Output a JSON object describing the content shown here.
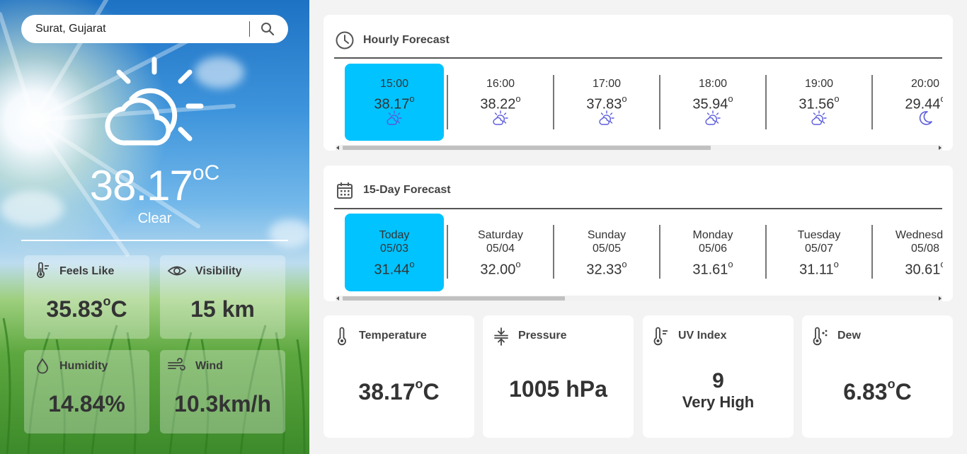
{
  "search": {
    "value": "Surat, Gujarat",
    "icon": "search-icon"
  },
  "current": {
    "temp": "38.17",
    "unit": "oC",
    "condition": "Clear",
    "icon": "sun-cloud-icon"
  },
  "tiles": {
    "feels_like": {
      "label": "Feels Like",
      "value": "35.83",
      "unit": "C",
      "deg": "o",
      "icon": "thermometer-icon"
    },
    "visibility": {
      "label": "Visibility",
      "value": "15 km",
      "icon": "eye-icon"
    },
    "humidity": {
      "label": "Humidity",
      "value": "14.84%",
      "icon": "droplet-icon"
    },
    "wind": {
      "label": "Wind",
      "value": "10.3km/h",
      "icon": "wind-icon"
    }
  },
  "hourly": {
    "title": "Hourly Forecast",
    "icon": "clock-icon",
    "items": [
      {
        "time": "15:00",
        "temp": "38.17",
        "deg": "o",
        "icon": "sun-cloud-icon"
      },
      {
        "time": "16:00",
        "temp": "38.22",
        "deg": "o",
        "icon": "sun-cloud-icon"
      },
      {
        "time": "17:00",
        "temp": "37.83",
        "deg": "o",
        "icon": "sun-cloud-icon"
      },
      {
        "time": "18:00",
        "temp": "35.94",
        "deg": "o",
        "icon": "sun-cloud-icon"
      },
      {
        "time": "19:00",
        "temp": "31.56",
        "deg": "o",
        "icon": "sun-cloud-icon"
      },
      {
        "time": "20:00",
        "temp": "29.44",
        "deg": "o",
        "icon": "moon-icon"
      }
    ]
  },
  "daily": {
    "title": "15-Day Forecast",
    "icon": "calendar-icon",
    "items": [
      {
        "day": "Today",
        "date": "05/03",
        "temp": "31.44",
        "deg": "o"
      },
      {
        "day": "Saturday",
        "date": "05/04",
        "temp": "32.00",
        "deg": "o"
      },
      {
        "day": "Sunday",
        "date": "05/05",
        "temp": "32.33",
        "deg": "o"
      },
      {
        "day": "Monday",
        "date": "05/06",
        "temp": "31.61",
        "deg": "o"
      },
      {
        "day": "Tuesday",
        "date": "05/07",
        "temp": "31.11",
        "deg": "o"
      },
      {
        "day": "Wednesday",
        "date": "05/08",
        "temp": "30.61",
        "deg": "o"
      }
    ]
  },
  "stats": {
    "temperature": {
      "label": "Temperature",
      "value": "38.17",
      "deg": "o",
      "unit": "C",
      "icon": "thermometer-icon"
    },
    "pressure": {
      "label": "Pressure",
      "value": "1005 hPa",
      "icon": "pressure-icon"
    },
    "uv": {
      "label": "UV Index",
      "value": "9",
      "level": "Very High",
      "icon": "uv-thermometer-icon"
    },
    "dew": {
      "label": "Dew",
      "value": "6.83",
      "deg": "o",
      "unit": "C",
      "icon": "dew-thermometer-icon"
    }
  },
  "colors": {
    "active_cell": "#00c3ff",
    "icon_accent": "#6a6be8"
  }
}
